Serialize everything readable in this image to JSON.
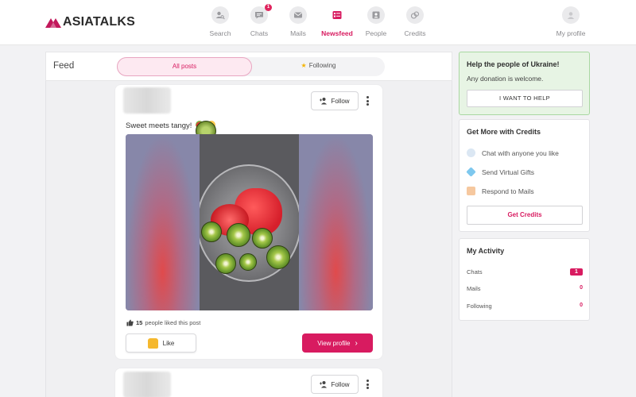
{
  "brand": {
    "name": "ASIATALKS",
    "accent": "#d81b60"
  },
  "nav": {
    "items": [
      {
        "key": "search",
        "label": "Search",
        "icon": "search-person-icon"
      },
      {
        "key": "chats",
        "label": "Chats",
        "icon": "chat-icon",
        "badge": "1"
      },
      {
        "key": "mails",
        "label": "Mails",
        "icon": "mail-icon"
      },
      {
        "key": "newsfeed",
        "label": "Newsfeed",
        "icon": "newsfeed-icon",
        "active": true
      },
      {
        "key": "people",
        "label": "People",
        "icon": "people-icon"
      },
      {
        "key": "credits",
        "label": "Credits",
        "icon": "coins-icon"
      }
    ],
    "profile_label": "My profile"
  },
  "feed": {
    "title": "Feed",
    "tabs": {
      "all": "All posts",
      "following": "Following"
    }
  },
  "posts": [
    {
      "follow_label": "Follow",
      "caption": "Sweet meets tangy!",
      "likes_count": "15",
      "likes_text": "people liked this post",
      "like_label": "Like",
      "view_label": "View profile"
    },
    {
      "follow_label": "Follow"
    }
  ],
  "sidebar": {
    "ukraine": {
      "title": "Help the people of Ukraine!",
      "subtitle": "Any donation is welcome.",
      "button": "I WANT TO HELP"
    },
    "credits": {
      "title": "Get More with Credits",
      "features": [
        "Chat with anyone you like",
        "Send Virtual Gifts",
        "Respond to Mails"
      ],
      "button": "Get Credits"
    },
    "activity": {
      "title": "My Activity",
      "rows": [
        {
          "label": "Chats",
          "value": "1"
        },
        {
          "label": "Mails",
          "value": "0"
        },
        {
          "label": "Following",
          "value": "0"
        }
      ]
    }
  }
}
